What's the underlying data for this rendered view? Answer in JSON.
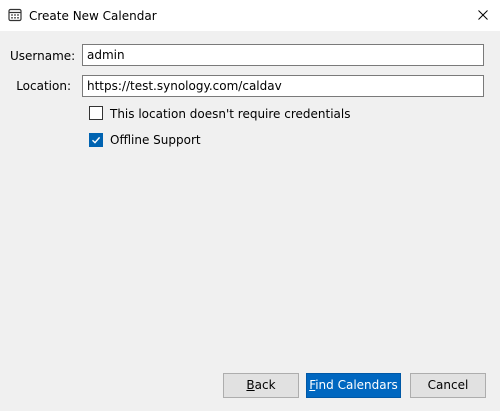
{
  "window": {
    "title": "Create New Calendar",
    "icon": "calendar-icon",
    "close_icon": "close-icon"
  },
  "form": {
    "username_label": "Username:",
    "username_value": "admin",
    "location_label": "Location:",
    "location_value": "https://test.synology.com/caldav"
  },
  "options": {
    "no_credentials_label": "This location doesn't require credentials",
    "no_credentials_checked": false,
    "offline_label": "Offline Support",
    "offline_checked": true
  },
  "buttons": {
    "back_mnemonic": "B",
    "back_rest": "ack",
    "find_mnemonic": "F",
    "find_rest": "ind Calendars",
    "cancel_label": "Cancel"
  },
  "colors": {
    "accent": "#0067c0",
    "checkbox_checked": "#0063b1",
    "dialog_background": "#f0f0f0"
  }
}
